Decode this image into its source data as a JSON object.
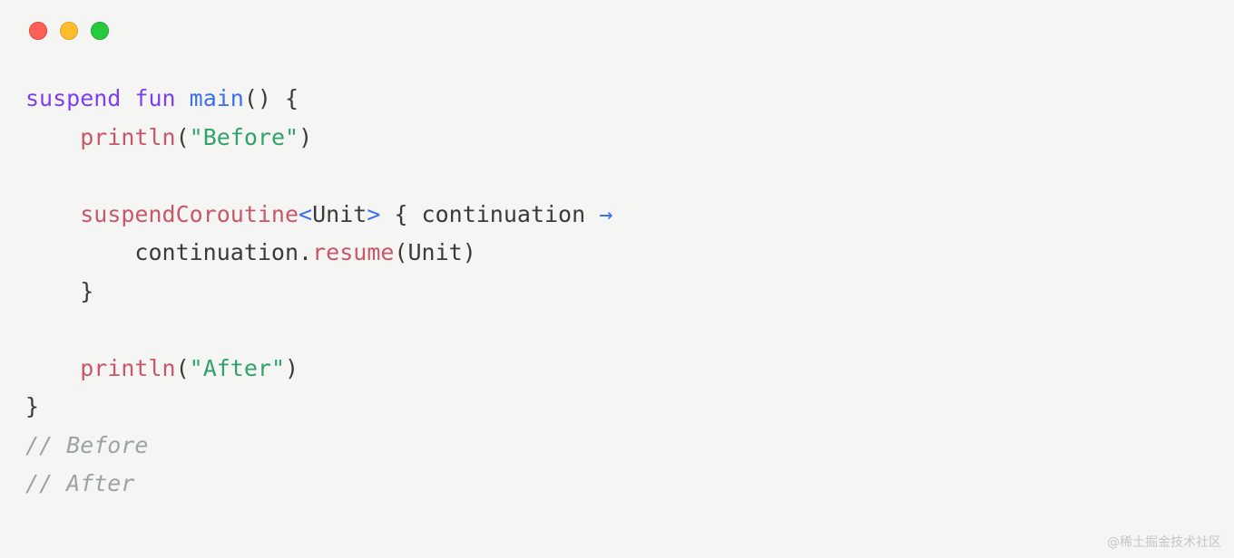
{
  "code": {
    "lines": [
      {
        "indent": 0,
        "tokens": [
          {
            "t": "suspend",
            "c": "tok-keyword"
          },
          {
            "t": " "
          },
          {
            "t": "fun",
            "c": "tok-keyword"
          },
          {
            "t": " "
          },
          {
            "t": "main",
            "c": "tok-funcname"
          },
          {
            "t": "()",
            "c": "tok-punct"
          },
          {
            "t": " {",
            "c": "tok-punct"
          }
        ]
      },
      {
        "indent": 1,
        "tokens": [
          {
            "t": "println",
            "c": "tok-call"
          },
          {
            "t": "(",
            "c": "tok-punct"
          },
          {
            "t": "\"Before\"",
            "c": "tok-string"
          },
          {
            "t": ")",
            "c": "tok-punct"
          }
        ]
      },
      {
        "indent": 0,
        "tokens": []
      },
      {
        "indent": 1,
        "tokens": [
          {
            "t": "suspendCoroutine",
            "c": "tok-call"
          },
          {
            "t": "<",
            "c": "tok-angle"
          },
          {
            "t": "Unit",
            "c": "tok-type"
          },
          {
            "t": ">",
            "c": "tok-angle"
          },
          {
            "t": " { ",
            "c": "tok-punct"
          },
          {
            "t": "continuation",
            "c": "tok-param"
          },
          {
            "t": " "
          },
          {
            "t": "→",
            "c": "tok-arrow"
          }
        ]
      },
      {
        "indent": 2,
        "tokens": [
          {
            "t": "continuation",
            "c": "tok-param"
          },
          {
            "t": ".",
            "c": "tok-punct"
          },
          {
            "t": "resume",
            "c": "tok-call"
          },
          {
            "t": "(",
            "c": "tok-punct"
          },
          {
            "t": "Unit",
            "c": "tok-type"
          },
          {
            "t": ")",
            "c": "tok-punct"
          }
        ]
      },
      {
        "indent": 1,
        "tokens": [
          {
            "t": "}",
            "c": "tok-punct"
          }
        ]
      },
      {
        "indent": 0,
        "tokens": []
      },
      {
        "indent": 1,
        "tokens": [
          {
            "t": "println",
            "c": "tok-call"
          },
          {
            "t": "(",
            "c": "tok-punct"
          },
          {
            "t": "\"After\"",
            "c": "tok-string"
          },
          {
            "t": ")",
            "c": "tok-punct"
          }
        ]
      },
      {
        "indent": 0,
        "tokens": [
          {
            "t": "}",
            "c": "tok-punct"
          }
        ]
      },
      {
        "indent": 0,
        "tokens": [
          {
            "t": "// Before",
            "c": "tok-comment"
          }
        ]
      },
      {
        "indent": 0,
        "tokens": [
          {
            "t": "// After",
            "c": "tok-comment"
          }
        ]
      }
    ],
    "indent_unit": "    "
  },
  "watermark": "@稀土掘金技术社区"
}
